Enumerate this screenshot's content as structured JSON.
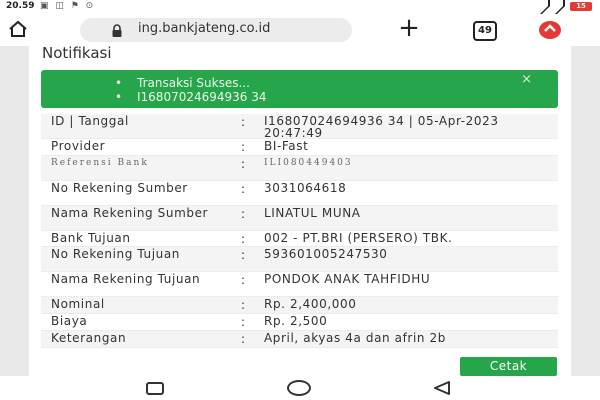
{
  "statusbar": {
    "time": "20.59",
    "notif_icons": "▣ ◫ ⚑ ⊙",
    "battery": "15"
  },
  "browser": {
    "url": "ing.bankjateng.co.id",
    "tab_count": "49"
  },
  "page": {
    "title": "Notifikasi",
    "alert": {
      "messages": [
        "Transaksi Sukses...",
        "I16807024694936 34"
      ],
      "close_symbol": "×"
    },
    "details": [
      {
        "label": "ID | Tanggal",
        "separator": ":",
        "value": "I16807024694936 34 | 05-Apr-2023 20:47:49"
      },
      {
        "label": "Provider",
        "separator": ":",
        "value": "BI-Fast"
      },
      {
        "label": "Referensi Bank",
        "separator": ":",
        "value": "ILI080449403"
      },
      {
        "label": "No Rekening Sumber",
        "separator": ":",
        "value": "3031064618"
      },
      {
        "label": "Nama Rekening Sumber",
        "separator": ":",
        "value": "LINATUL MUNA"
      },
      {
        "label": "Bank Tujuan",
        "separator": ":",
        "value": "002 - PT.BRI (PERSERO) TBK."
      },
      {
        "label": "No Rekening Tujuan",
        "separator": ":",
        "value": "593601005247530"
      },
      {
        "label": "Nama Rekening Tujuan",
        "separator": ":",
        "value": "PONDOK ANAK TAHFIDHU"
      },
      {
        "label": "Nominal",
        "separator": ":",
        "value": "Rp. 2,400,000"
      },
      {
        "label": "Biaya",
        "separator": ":",
        "value": "Rp. 2,500"
      },
      {
        "label": "Keterangan",
        "separator": ":",
        "value": "April, akyas 4a dan afrin 2b"
      }
    ],
    "print_button": "Cetak"
  },
  "colors": {
    "accent": "#27a54a",
    "battery": "#e53935"
  },
  "icons": {
    "home": "home-icon",
    "lock": "lock-icon",
    "new_tab": "plus-icon",
    "tabs": "tabs-icon",
    "extension": "extension-icon",
    "nav_recent": "recent-apps-icon",
    "nav_home": "nav-home-icon",
    "nav_back": "back-icon"
  }
}
